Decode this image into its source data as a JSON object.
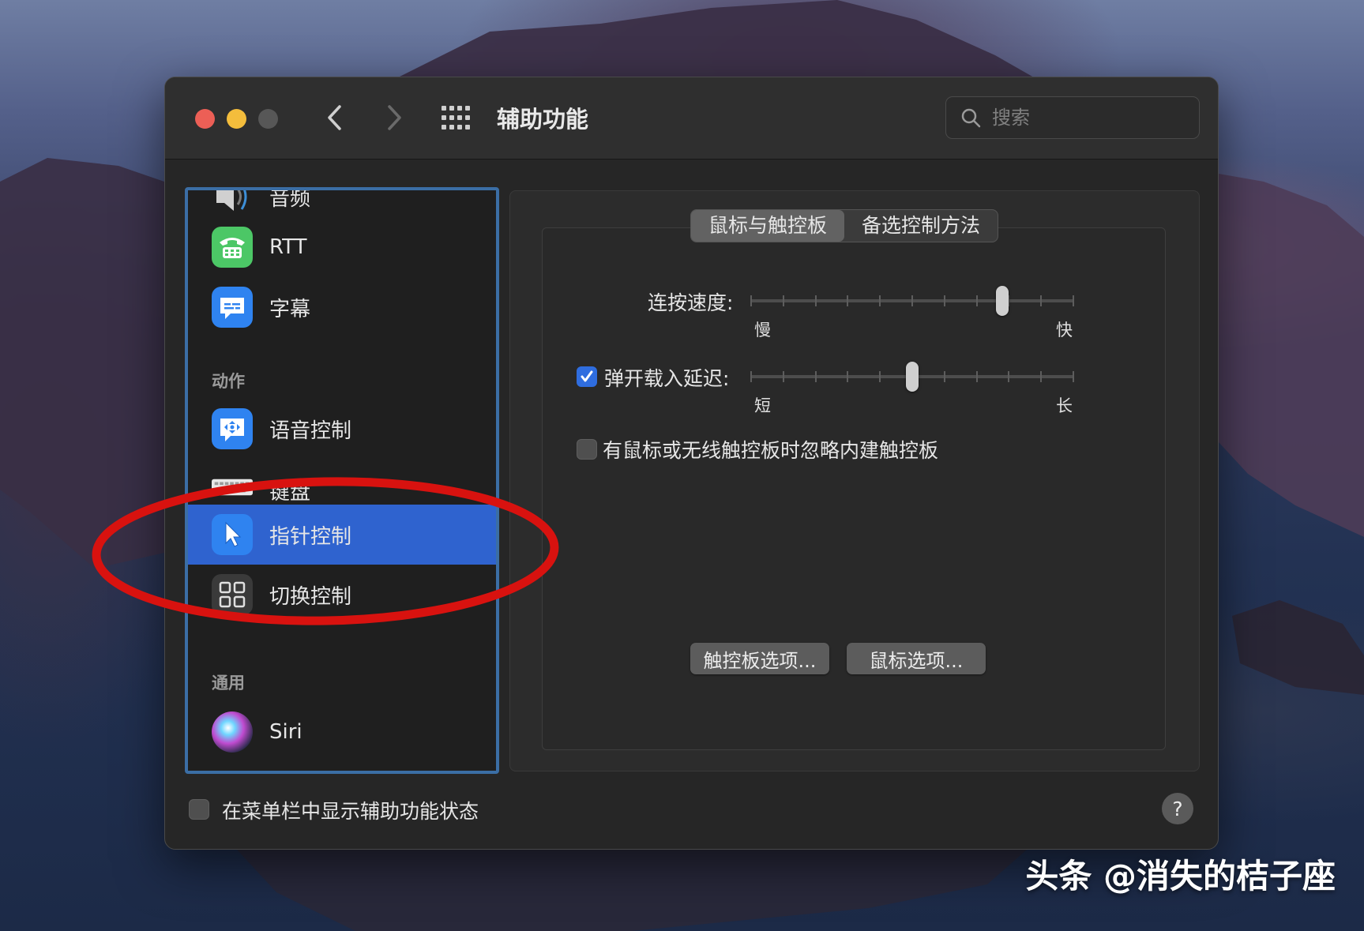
{
  "window": {
    "title": "辅助功能",
    "search_placeholder": "搜索"
  },
  "sidebar": {
    "items": [
      {
        "label": "音频",
        "icon": "speaker-icon"
      },
      {
        "label": "RTT",
        "icon": "rtt-phone-icon"
      },
      {
        "label": "字幕",
        "icon": "captions-icon"
      },
      {
        "label": "语音控制",
        "icon": "voice-control-icon"
      },
      {
        "label": "键盘",
        "icon": "keyboard-icon"
      },
      {
        "label": "指针控制",
        "icon": "pointer-icon",
        "selected": true
      },
      {
        "label": "切换控制",
        "icon": "switch-control-icon"
      },
      {
        "label": "Siri",
        "icon": "siri-icon"
      }
    ],
    "sections": {
      "motor": "动作",
      "general": "通用"
    }
  },
  "tabs": [
    {
      "label": "鼠标与触控板",
      "active": true
    },
    {
      "label": "备选控制方法",
      "active": false
    }
  ],
  "settings": {
    "double_click_speed": {
      "label": "连按速度:",
      "min_label": "慢",
      "max_label": "快",
      "tick_count": 11,
      "value_fraction": 0.79
    },
    "spring_loading": {
      "label": "弹开载入延迟:",
      "checked": true,
      "min_label": "短",
      "max_label": "长",
      "tick_count": 11,
      "value_fraction": 0.5
    },
    "ignore_trackpad": {
      "label": "有鼠标或无线触控板时忽略内建触控板",
      "checked": false
    }
  },
  "buttons": {
    "trackpad_options": "触控板选项...",
    "mouse_options": "鼠标选项..."
  },
  "footer": {
    "show_status_label": "在菜单栏中显示辅助功能状态",
    "show_status_checked": false,
    "help": "?"
  },
  "watermark": "头条 @消失的桔子座",
  "colors": {
    "accent": "#2f63cf",
    "annotation_red": "#d8120f",
    "close": "#ec5f56",
    "minimize": "#f4bd3c"
  }
}
